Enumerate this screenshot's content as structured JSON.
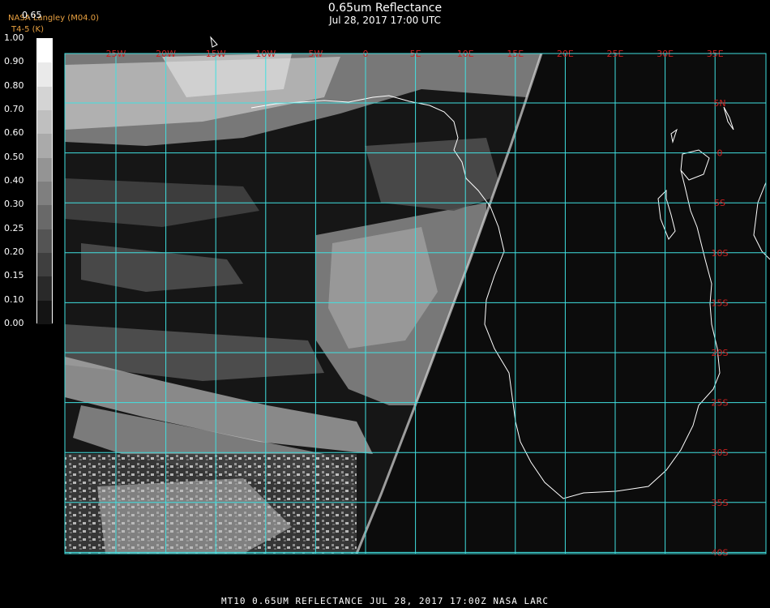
{
  "header": {
    "title": "0.65um Reflectance",
    "datetime": "Jul 28, 2017 17:00 UTC",
    "credit_line1": "NASA Langley (M04.0)",
    "credit_line2": "T4-5 (K)",
    "colorbar_top_label": "0.65"
  },
  "colorbar": {
    "labels": [
      "1.00",
      "0.90",
      "0.80",
      "0.70",
      "0.60",
      "0.50",
      "0.40",
      "0.30",
      "0.25",
      "0.20",
      "0.15",
      "0.10",
      "0.00"
    ]
  },
  "map": {
    "lon_labels": [
      "25W",
      "20W",
      "15W",
      "10W",
      "5W",
      "0",
      "5E",
      "10E",
      "15E",
      "20E",
      "25E",
      "30E",
      "35E"
    ],
    "lat_labels": [
      "5N",
      "0",
      "5S",
      "10S",
      "15S",
      "20S",
      "25S",
      "30S",
      "35S",
      "40S"
    ],
    "grid_color": "#40e0e0",
    "label_color": "#cc2020",
    "coast_color": "#ffffff"
  },
  "footer": {
    "text": "MT10  0.65UM REFLECTANCE   JUL 28, 2017 17:00Z   NASA LARC"
  }
}
